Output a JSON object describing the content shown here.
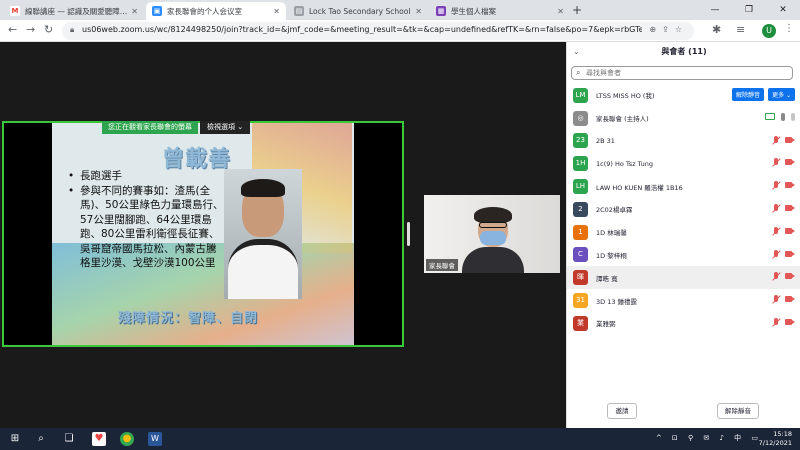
{
  "browser": {
    "tabs": [
      {
        "title": "線聯講座 — 認識及關愛聽障人士",
        "favicon": "M",
        "color": "#ea4335",
        "active": false
      },
      {
        "title": "家長聯會的个人会议室",
        "favicon": "▣",
        "color": "#2d8cff",
        "active": true
      },
      {
        "title": "Lock Tao Secondary School",
        "favicon": "▤",
        "color": "#5f6368",
        "active": false
      },
      {
        "title": "學生個人檔案",
        "favicon": "▦",
        "color": "#7b3fb8",
        "active": false
      }
    ],
    "url": "us06web.zoom.us/wc/8124498250/join?track_id=&jmf_code=&meeting_result=&tk=&cap=undefined&refTK=&rn=false&po=7&epk=rbGTec4VvxYdw...",
    "profile_initial": "U"
  },
  "share": {
    "notice": "您正在觀看家長聯會的螢幕",
    "view_options": "檢視選項 ⌄",
    "slide_title": "曾載善",
    "bullets": [
      "長跑選手",
      "參與不同的賽事如：渣馬(全馬)、50公里綠色力量環島行、57公里闊腳跑、64公里環島跑、80公里雷利衛徑長征賽、吳哥窟帝國馬拉松、內蒙古騰格里沙漠、戈壁沙漠100公里"
    ],
    "slide_subtitle": "殘障情況：智障、自閉"
  },
  "video": {
    "name": "家長聯會"
  },
  "participants": {
    "header": "與會者 (11)",
    "search_placeholder": "尋找與會者",
    "unmute_label": "解除靜音",
    "more_label": "更多 ⌄",
    "list": [
      {
        "initials": "LM",
        "name": "LTSS MISS HO (我)",
        "color": "#2da44e",
        "state": "self"
      },
      {
        "initials": "◎",
        "name": "家長聯會 (主持人)",
        "color": "#8c8c8c",
        "state": "host"
      },
      {
        "initials": "23",
        "name": "2B 31",
        "color": "#2da44e",
        "state": "muted"
      },
      {
        "initials": "1H",
        "name": "1c(9) Ho Tsz Tung",
        "color": "#2da44e",
        "state": "muted"
      },
      {
        "initials": "LH",
        "name": "LAW HO KUEN 羅浩權 1B16",
        "color": "#2da44e",
        "state": "muted"
      },
      {
        "initials": "2",
        "name": "2C02楊卓霖",
        "color": "#3a4a5e",
        "state": "muted"
      },
      {
        "initials": "1",
        "name": "1D 林瑞馨",
        "color": "#e8710a",
        "state": "muted"
      },
      {
        "initials": "C",
        "name": "1D 黎梓桐",
        "color": "#6a4fbf",
        "state": "muted"
      },
      {
        "initials": "暉",
        "name": "譚晧 寬",
        "color": "#c0392b",
        "state": "muted-hl"
      },
      {
        "initials": "31",
        "name": "3D 13 鍾禮霆",
        "color": "#f5a623",
        "state": "muted"
      },
      {
        "initials": "業",
        "name": "業雅弼",
        "color": "#c0392b",
        "state": "muted"
      }
    ],
    "invite_label": "邀請",
    "unmute_all_label": "解除靜音"
  },
  "taskbar": {
    "time": "15:18",
    "date": "7/12/2021",
    "ime": "中"
  }
}
